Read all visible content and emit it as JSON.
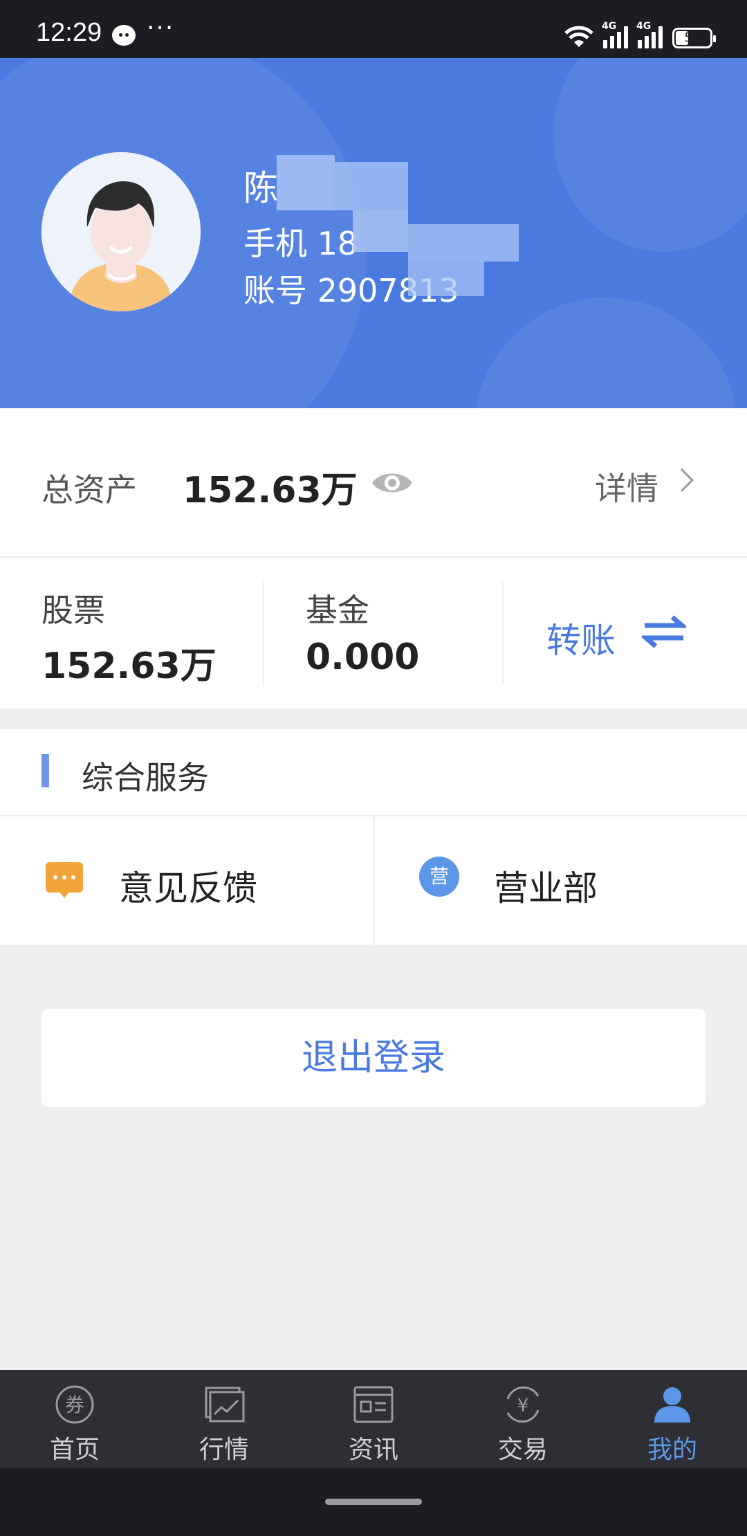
{
  "status_bar": {
    "time": "12:29",
    "dots": "···",
    "network_1": "4G",
    "network_2": "4G",
    "battery": "51"
  },
  "profile": {
    "name": "陈",
    "phone": "手机 18",
    "account": "账号 2907813",
    "avatar_icon": "user-avatar-icon"
  },
  "assets": {
    "total_label": "总资产",
    "total_value": "152.63万",
    "detail_label": "详情",
    "stocks_label": "股票",
    "stocks_value": "152.63万",
    "fund_label": "基金",
    "fund_value": "0.000",
    "transfer_label": "转账"
  },
  "services": {
    "title": "综合服务",
    "items": [
      {
        "label": "意见反馈",
        "icon": "feedback-icon"
      },
      {
        "label": "营业部",
        "icon": "branch-icon",
        "icon_text": "营"
      }
    ]
  },
  "logout_label": "退出登录",
  "tabs": [
    {
      "label": "首页",
      "icon": "home-coupon-icon",
      "icon_text": "券"
    },
    {
      "label": "行情",
      "icon": "market-chart-icon"
    },
    {
      "label": "资讯",
      "icon": "news-icon"
    },
    {
      "label": "交易",
      "icon": "trade-yen-icon",
      "icon_text": "¥"
    },
    {
      "label": "我的",
      "icon": "profile-person-icon",
      "active": true
    }
  ],
  "colors": {
    "brand_blue": "#4a7ae0",
    "active_tab": "#5b97e6",
    "feedback_orange": "#f2a43a"
  }
}
